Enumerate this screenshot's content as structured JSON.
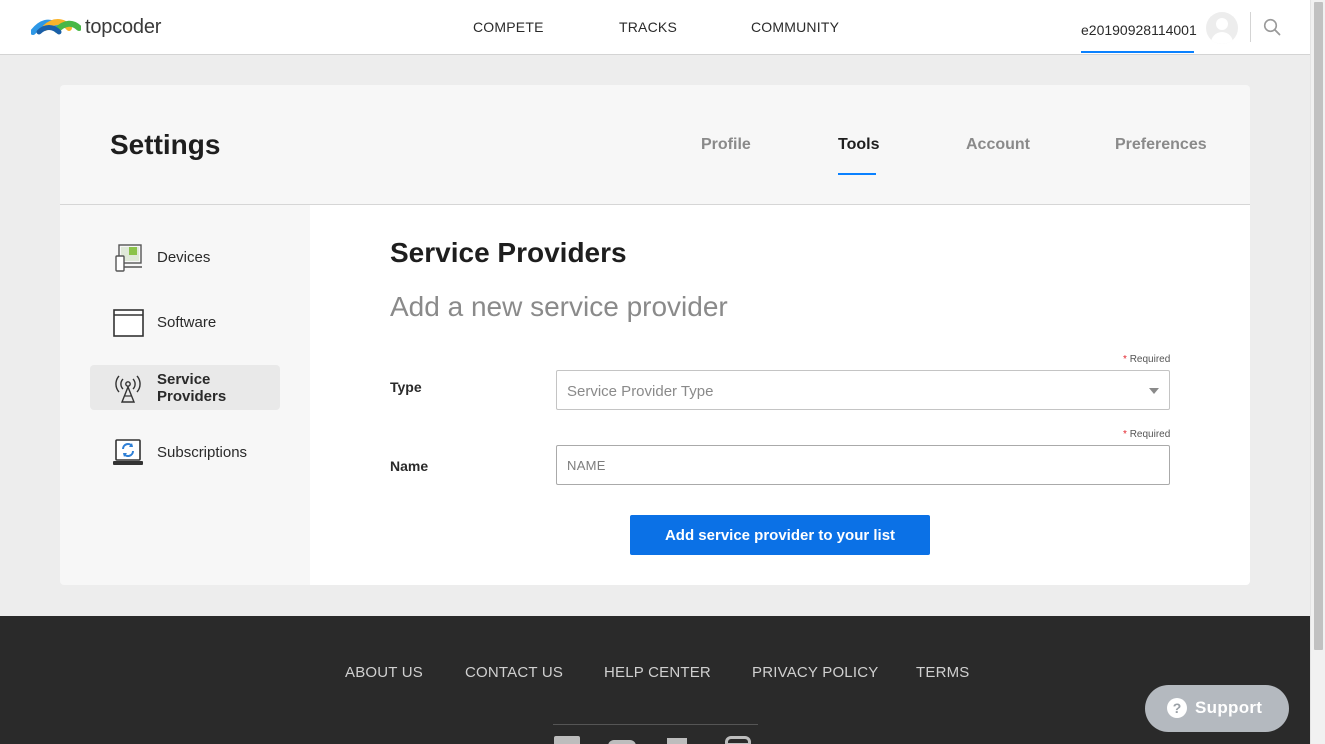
{
  "header": {
    "logo_text": "topcoder",
    "nav": [
      "COMPETE",
      "TRACKS",
      "COMMUNITY"
    ],
    "username": "e20190928114001"
  },
  "settings": {
    "title": "Settings",
    "tabs": [
      {
        "label": "Profile",
        "active": false
      },
      {
        "label": "Tools",
        "active": true
      },
      {
        "label": "Account",
        "active": false
      },
      {
        "label": "Preferences",
        "active": false
      }
    ],
    "sidebar": [
      {
        "label": "Devices",
        "icon": "devices-icon",
        "active": false
      },
      {
        "label": "Software",
        "icon": "software-icon",
        "active": false
      },
      {
        "label": "Service Providers",
        "icon": "service-providers-icon",
        "active": true
      },
      {
        "label": "Subscriptions",
        "icon": "subscriptions-icon",
        "active": false
      }
    ]
  },
  "form": {
    "section_title": "Service Providers",
    "section_subtitle": "Add a new service provider",
    "required_star": "*",
    "required_text": "Required",
    "type_label": "Type",
    "type_placeholder": "Service Provider Type",
    "name_label": "Name",
    "name_placeholder": "NAME",
    "submit_label": "Add service provider to your list"
  },
  "footer": {
    "links": [
      "ABOUT US",
      "CONTACT US",
      "HELP CENTER",
      "PRIVACY POLICY",
      "TERMS"
    ]
  },
  "support": {
    "icon_glyph": "?",
    "label": "Support"
  },
  "colors": {
    "accent": "#0a81ff",
    "button": "#0b71e6",
    "required": "#e3262e",
    "footer_bg": "#2a2a2a"
  }
}
